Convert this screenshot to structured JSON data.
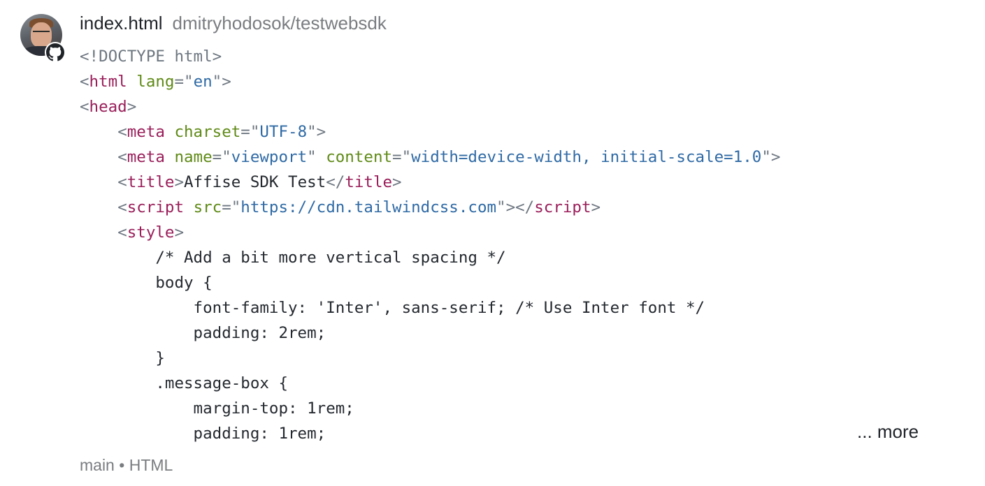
{
  "header": {
    "filename": "index.html",
    "repo": "dmitryhodosok/testwebsdk",
    "avatar_icon": "user-avatar",
    "badge_icon": "github-icon"
  },
  "code_lines": [
    [
      [
        "doctype",
        "<!DOCTYPE html>"
      ]
    ],
    [
      [
        "punct",
        "<"
      ],
      [
        "tag",
        "html"
      ],
      [
        "plain",
        " "
      ],
      [
        "attr",
        "lang"
      ],
      [
        "punct",
        "=\""
      ],
      [
        "str",
        "en"
      ],
      [
        "punct",
        "\">"
      ]
    ],
    [
      [
        "punct",
        "<"
      ],
      [
        "tag",
        "head"
      ],
      [
        "punct",
        ">"
      ]
    ],
    [
      [
        "plain",
        "    "
      ],
      [
        "punct",
        "<"
      ],
      [
        "tag",
        "meta"
      ],
      [
        "plain",
        " "
      ],
      [
        "attr",
        "charset"
      ],
      [
        "punct",
        "=\""
      ],
      [
        "str",
        "UTF-8"
      ],
      [
        "punct",
        "\">"
      ]
    ],
    [
      [
        "plain",
        "    "
      ],
      [
        "punct",
        "<"
      ],
      [
        "tag",
        "meta"
      ],
      [
        "plain",
        " "
      ],
      [
        "attr",
        "name"
      ],
      [
        "punct",
        "=\""
      ],
      [
        "str",
        "viewport"
      ],
      [
        "punct",
        "\""
      ],
      [
        "plain",
        " "
      ],
      [
        "attr",
        "content"
      ],
      [
        "punct",
        "=\""
      ],
      [
        "str",
        "width=device-width, initial-scale=1.0"
      ],
      [
        "punct",
        "\">"
      ]
    ],
    [
      [
        "plain",
        "    "
      ],
      [
        "punct",
        "<"
      ],
      [
        "tag",
        "title"
      ],
      [
        "punct",
        ">"
      ],
      [
        "plain",
        "Affise SDK Test"
      ],
      [
        "punct",
        "</"
      ],
      [
        "tag",
        "title"
      ],
      [
        "punct",
        ">"
      ]
    ],
    [
      [
        "plain",
        "    "
      ],
      [
        "punct",
        "<"
      ],
      [
        "tag",
        "script"
      ],
      [
        "plain",
        " "
      ],
      [
        "attr",
        "src"
      ],
      [
        "punct",
        "=\""
      ],
      [
        "str",
        "https://cdn.tailwindcss.com"
      ],
      [
        "punct",
        "\"></"
      ],
      [
        "tag",
        "script"
      ],
      [
        "punct",
        ">"
      ]
    ],
    [
      [
        "plain",
        "    "
      ],
      [
        "punct",
        "<"
      ],
      [
        "tag",
        "style"
      ],
      [
        "punct",
        ">"
      ]
    ],
    [
      [
        "plain",
        "        /* Add a bit more vertical spacing */"
      ]
    ],
    [
      [
        "plain",
        "        body {"
      ]
    ],
    [
      [
        "plain",
        "            font-family: 'Inter', sans-serif; /* Use Inter font */"
      ]
    ],
    [
      [
        "plain",
        "            padding: 2rem;"
      ]
    ],
    [
      [
        "plain",
        "        }"
      ]
    ],
    [
      [
        "plain",
        "        .message-box {"
      ]
    ],
    [
      [
        "plain",
        "            margin-top: 1rem;"
      ]
    ],
    [
      [
        "plain",
        "            padding: 1rem;"
      ]
    ]
  ],
  "more_label": "... more",
  "footer": {
    "branch": "main",
    "separator": "•",
    "language": "HTML"
  },
  "colors": {
    "tag": "#9a1f5a",
    "attr": "#5f8a16",
    "string": "#2f6aa5",
    "punct": "#6e7781",
    "text": "#24292f"
  }
}
